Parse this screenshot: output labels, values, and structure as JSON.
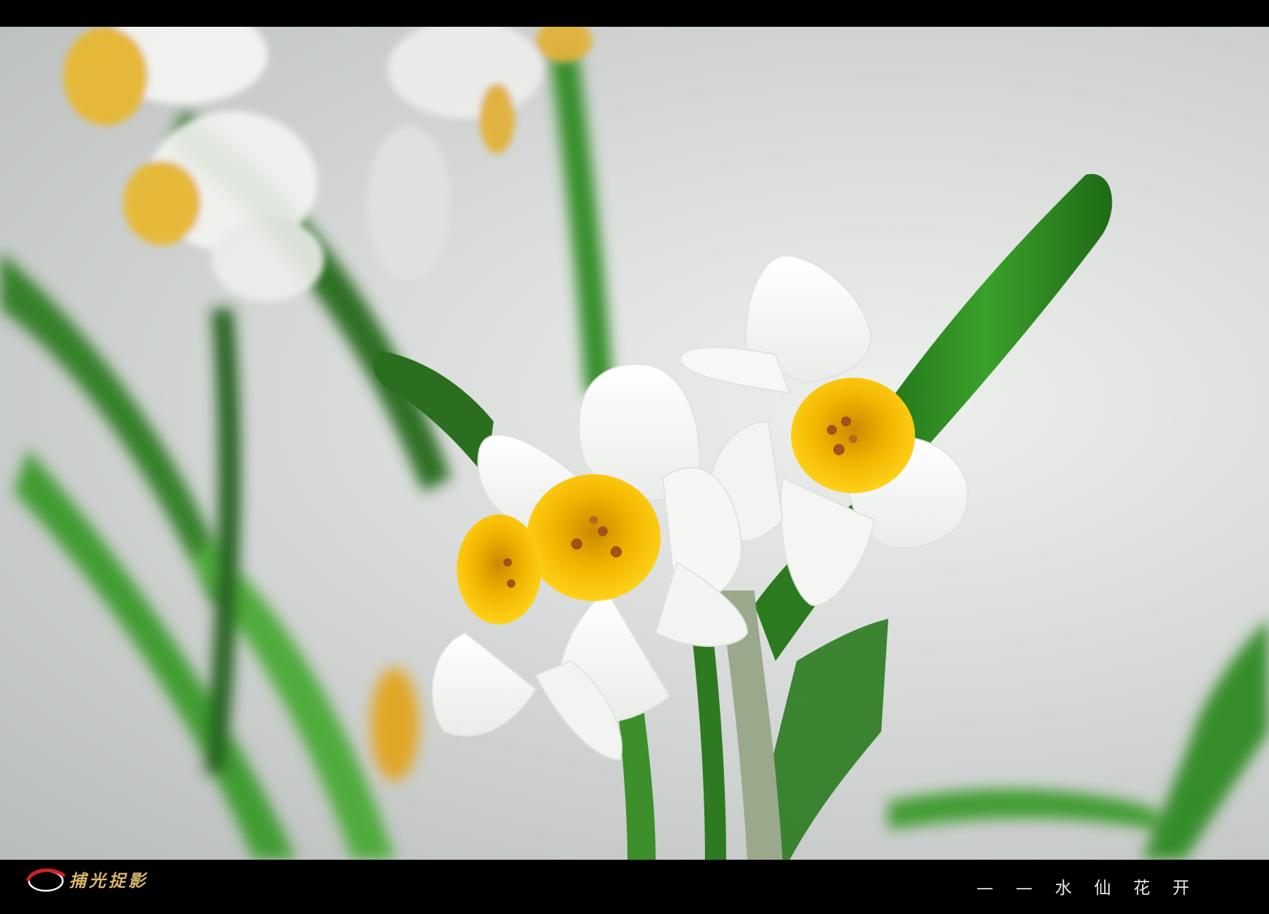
{
  "photo": {
    "subject": "narcissus-flowers",
    "colors": {
      "petal": "#ffffff",
      "corona": "#f2b800",
      "leaf": "#2f8a22",
      "background": "#d9dcda",
      "border": "#000000"
    }
  },
  "watermark": {
    "signature": "捕光捉影",
    "logo_icon": "red-arc-logo-icon"
  },
  "caption": {
    "text": "— — 水 仙 花 开"
  }
}
